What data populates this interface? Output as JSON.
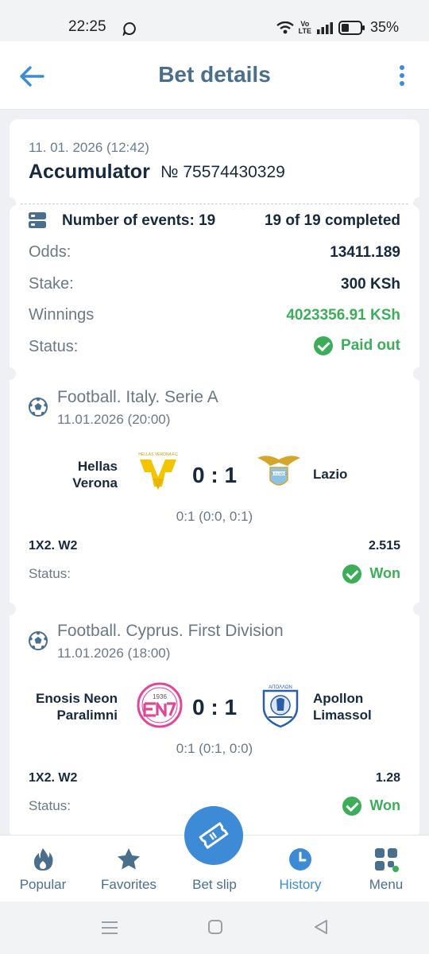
{
  "status_bar": {
    "time": "22:25",
    "battery": "35%",
    "net_top": "Vo",
    "net_bottom": "LTE"
  },
  "header": {
    "title": "Bet details"
  },
  "bet": {
    "datetime": "11. 01. 2026 (12:42)",
    "type": "Accumulator",
    "number": "№ 75574430329",
    "events_label": "Number of events: 19",
    "events_completed": "19 of 19 completed",
    "odds_label": "Odds:",
    "odds_value": "13411.189",
    "stake_label": "Stake:",
    "stake_value": "300 KSh",
    "winnings_label": "Winnings",
    "winnings_value": "4023356.91 KSh",
    "status_label": "Status:",
    "status_value": "Paid out"
  },
  "events": [
    {
      "league": "Football.  Italy.  Serie A",
      "date": "11.01.2026 (20:00)",
      "home_line1": "Hellas",
      "home_line2": "Verona",
      "away_line1": "Lazio",
      "away_line2": "",
      "home_logo_text": "HELLAS VERONA FC",
      "away_logo_text": "S.S.LAZIO",
      "score": "0 : 1",
      "detail": "0:1 (0:0, 0:1)",
      "market": "1X2. W2",
      "odd": "2.515",
      "status_label": "Status:",
      "status_value": "Won"
    },
    {
      "league": "Football.  Cyprus.  First Division",
      "date": "11.01.2026 (18:00)",
      "home_line1": "Enosis Neon",
      "home_line2": "Paralimni",
      "away_line1": "Apollon",
      "away_line2": "Limassol",
      "home_logo_text": "1936",
      "away_logo_text": "ΑΠΟΛΛΩΝ",
      "score": "0 : 1",
      "detail": "0:1 (0:1, 0:0)",
      "market": "1X2. W2",
      "odd": "1.28",
      "status_label": "Status:",
      "status_value": "Won"
    }
  ],
  "nav": {
    "popular": "Popular",
    "favorites": "Favorites",
    "betslip": "Bet slip",
    "history": "History",
    "menu": "Menu"
  },
  "colors": {
    "accent": "#3d8bd6",
    "win": "#3cae5a",
    "title": "#4a6f8c"
  }
}
